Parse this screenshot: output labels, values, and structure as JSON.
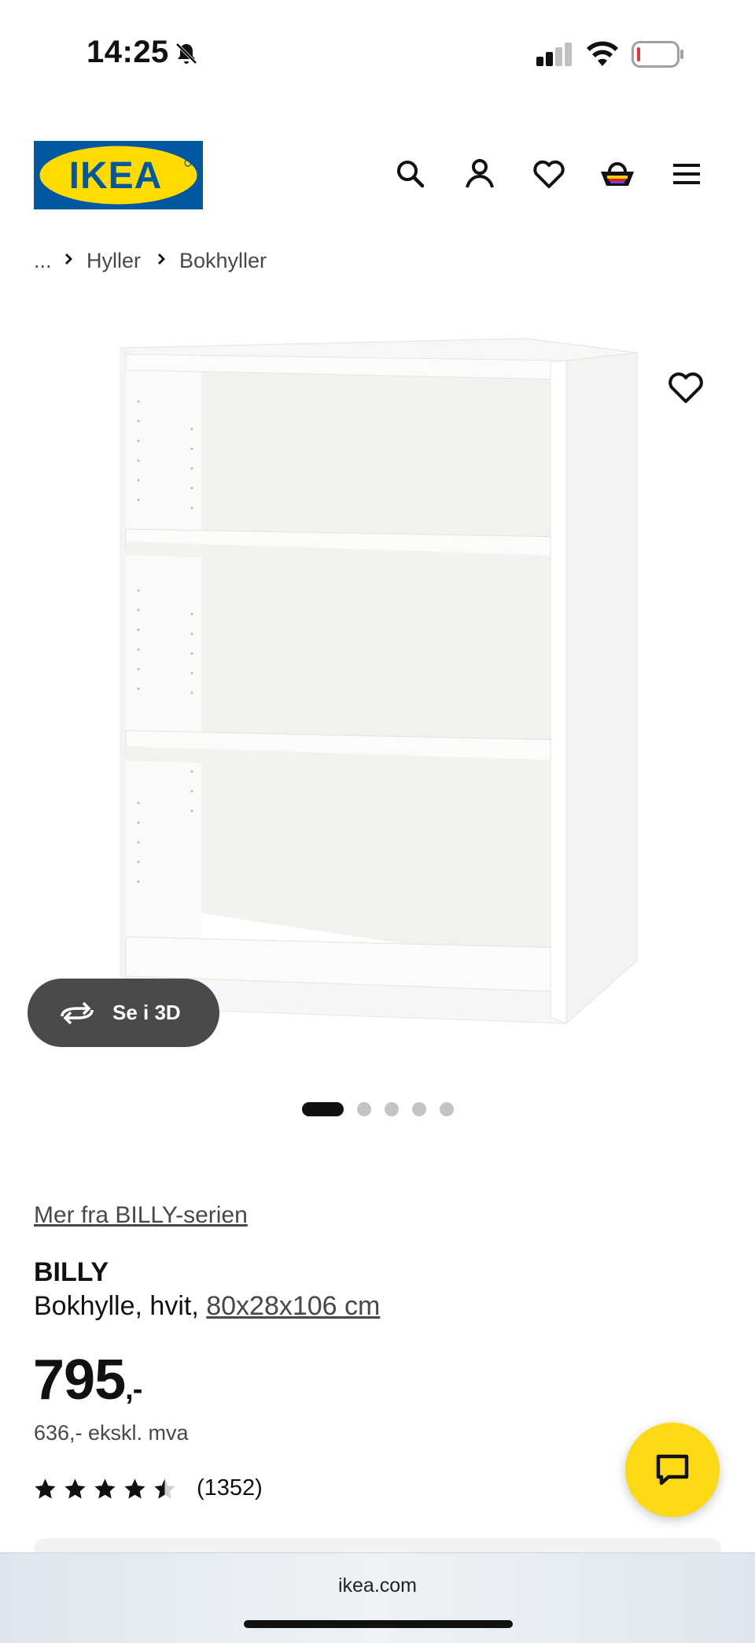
{
  "status_bar": {
    "time": "14:25"
  },
  "header": {
    "logo_text": "IKEA",
    "icons": [
      "search-icon",
      "account-icon",
      "heart-icon",
      "cart-icon",
      "menu-icon"
    ]
  },
  "breadcrumb": {
    "items": [
      "...",
      "Hyller",
      "Bokhyller"
    ]
  },
  "gallery": {
    "view_3d_label": "Se i 3D",
    "total_images": 5,
    "active_index": 0
  },
  "product": {
    "series_link": "Mer fra BILLY-serien",
    "name": "BILLY",
    "description": "Bokhylle, hvit, ",
    "size_link": "80x28x106 cm",
    "price": "795",
    "price_suffix": ",-",
    "price_ex_vat": "636,- ekskl. mva",
    "rating": 4.5,
    "review_count": "(1352)"
  },
  "browser": {
    "url": "ikea.com"
  },
  "colors": {
    "ikea_blue": "#0058a3",
    "ikea_yellow": "#ffdb00",
    "chat_yellow": "#fbd914"
  }
}
